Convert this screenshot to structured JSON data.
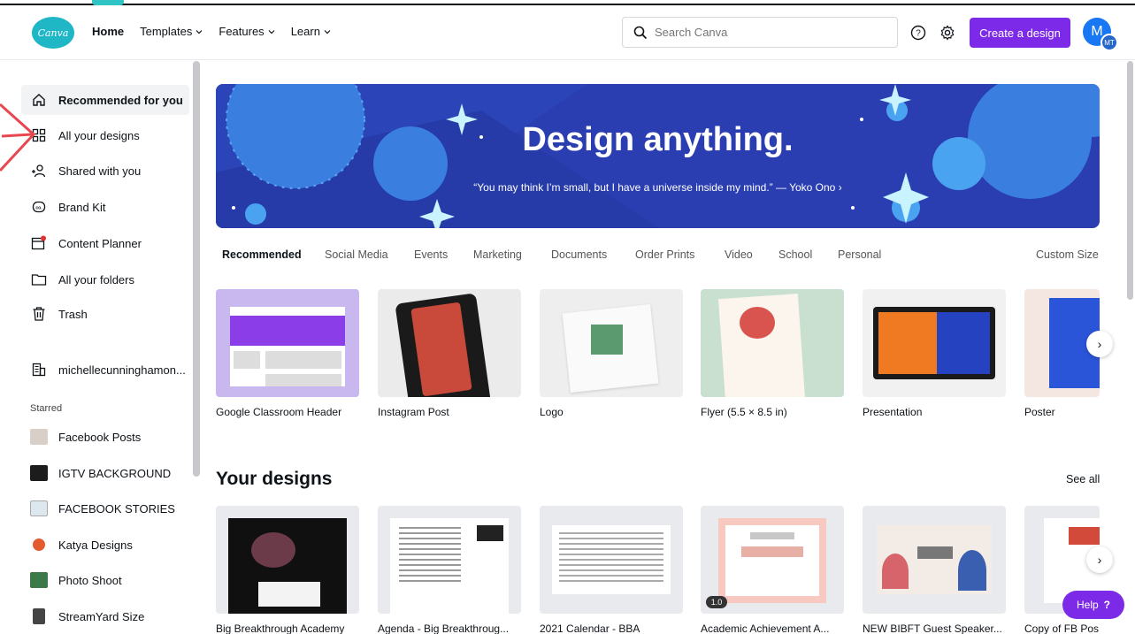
{
  "header": {
    "logo_text": "Canva",
    "nav": [
      {
        "label": "Home"
      },
      {
        "label": "Templates"
      },
      {
        "label": "Features"
      },
      {
        "label": "Learn"
      }
    ],
    "search_placeholder": "Search Canva",
    "create_label": "Create a design",
    "avatar_initial": "M",
    "avatar_badge": "MT"
  },
  "sidebar": {
    "items": [
      {
        "label": "Recommended for you",
        "icon": "home-icon"
      },
      {
        "label": "All your designs",
        "icon": "grid-icon"
      },
      {
        "label": "Shared with you",
        "icon": "people-icon"
      },
      {
        "label": "Brand Kit",
        "icon": "brand-kit-icon"
      },
      {
        "label": "Content Planner",
        "icon": "calendar-icon"
      },
      {
        "label": "All your folders",
        "icon": "folder-icon"
      },
      {
        "label": "Trash",
        "icon": "trash-icon"
      },
      {
        "label": "michellecunninghamon...",
        "icon": "team-icon"
      }
    ],
    "starred_heading": "Starred",
    "starred": [
      {
        "label": "Facebook Posts",
        "color": "#d8d0c8"
      },
      {
        "label": "IGTV BACKGROUND",
        "color": "#1c1c1c"
      },
      {
        "label": "FACEBOOK STORIES",
        "color": "#dde8ee"
      },
      {
        "label": "Katya Designs",
        "color": "#e35b2c"
      },
      {
        "label": "Photo Shoot",
        "color": "#3d7a4a"
      },
      {
        "label": "StreamYard Size",
        "color": "#444444"
      }
    ]
  },
  "hero": {
    "title": "Design anything.",
    "subtitle": "“You may think I’m small, but I have a universe inside my mind.” — Yoko Ono ›"
  },
  "tabs": [
    "Recommended",
    "Social Media",
    "Events",
    "Marketing",
    "Documents",
    "Order Prints",
    "Video",
    "School",
    "Personal",
    "Custom Size"
  ],
  "templates": [
    {
      "label": "Google Classroom Header"
    },
    {
      "label": "Instagram Post"
    },
    {
      "label": "Logo"
    },
    {
      "label": "Flyer (5.5 × 8.5 in)"
    },
    {
      "label": "Presentation"
    },
    {
      "label": "Poster"
    }
  ],
  "designs_section": {
    "title": "Your designs",
    "see_all": "See all",
    "items": [
      {
        "label": "Big Breakthrough Academy"
      },
      {
        "label": "Agenda - Big Breakthroug..."
      },
      {
        "label": "2021 Calendar - BBA"
      },
      {
        "label": "Academic Achievement A..."
      },
      {
        "label": "NEW BIBFT Guest Speaker..."
      },
      {
        "label": "Copy of FB Pos"
      }
    ],
    "version_badge": "1.0"
  },
  "help_label": "Help",
  "help_mark": "?"
}
